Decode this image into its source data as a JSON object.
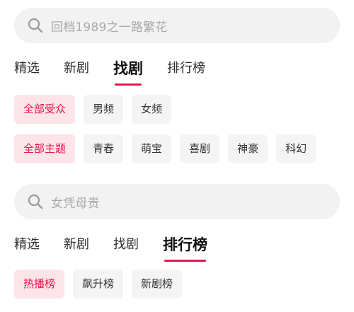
{
  "section1": {
    "search_placeholder": "回档1989之一路繁花",
    "tabs": [
      "精选",
      "新剧",
      "找剧",
      "排行榜"
    ],
    "audience_chips": [
      "全部受众",
      "男频",
      "女频"
    ],
    "theme_chips": [
      "全部主题",
      "青春",
      "萌宝",
      "喜剧",
      "神豪",
      "科幻"
    ]
  },
  "section2": {
    "search_placeholder": "女凭母贵",
    "tabs": [
      "精选",
      "新剧",
      "找剧",
      "排行榜"
    ],
    "rank_chips": [
      "热播榜",
      "飙升榜",
      "新剧榜"
    ]
  },
  "colors": {
    "accent": "#e5184d",
    "chip_active_bg": "#fde4e9",
    "chip_bg": "#f4f4f4",
    "search_bg": "#f2f2f2"
  },
  "icons": {
    "search": "search-icon"
  }
}
